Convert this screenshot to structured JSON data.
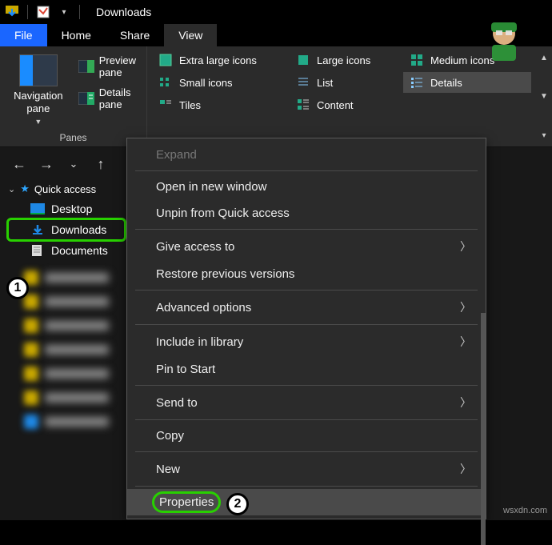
{
  "window": {
    "title": "Downloads"
  },
  "ribbon": {
    "tabs": {
      "file": "File",
      "home": "Home",
      "share": "Share",
      "view": "View"
    },
    "panes_group_label": "Panes",
    "navigation_pane": "Navigation pane",
    "preview_pane": "Preview pane",
    "details_pane": "Details pane",
    "layouts": {
      "xl": "Extra large icons",
      "large": "Large icons",
      "medium": "Medium icons",
      "small": "Small icons",
      "list": "List",
      "details": "Details",
      "tiles": "Tiles",
      "content": "Content"
    }
  },
  "tree": {
    "quick_access": "Quick access",
    "desktop": "Desktop",
    "downloads": "Downloads",
    "documents": "Documents"
  },
  "context_menu": {
    "expand": "Expand",
    "open_new": "Open in new window",
    "unpin": "Unpin from Quick access",
    "give_access": "Give access to",
    "restore": "Restore previous versions",
    "advanced": "Advanced options",
    "include": "Include in library",
    "pin_start": "Pin to Start",
    "send_to": "Send to",
    "copy": "Copy",
    "new": "New",
    "properties": "Properties"
  },
  "callouts": {
    "one": "1",
    "two": "2"
  },
  "watermark": "wsxdn.com"
}
